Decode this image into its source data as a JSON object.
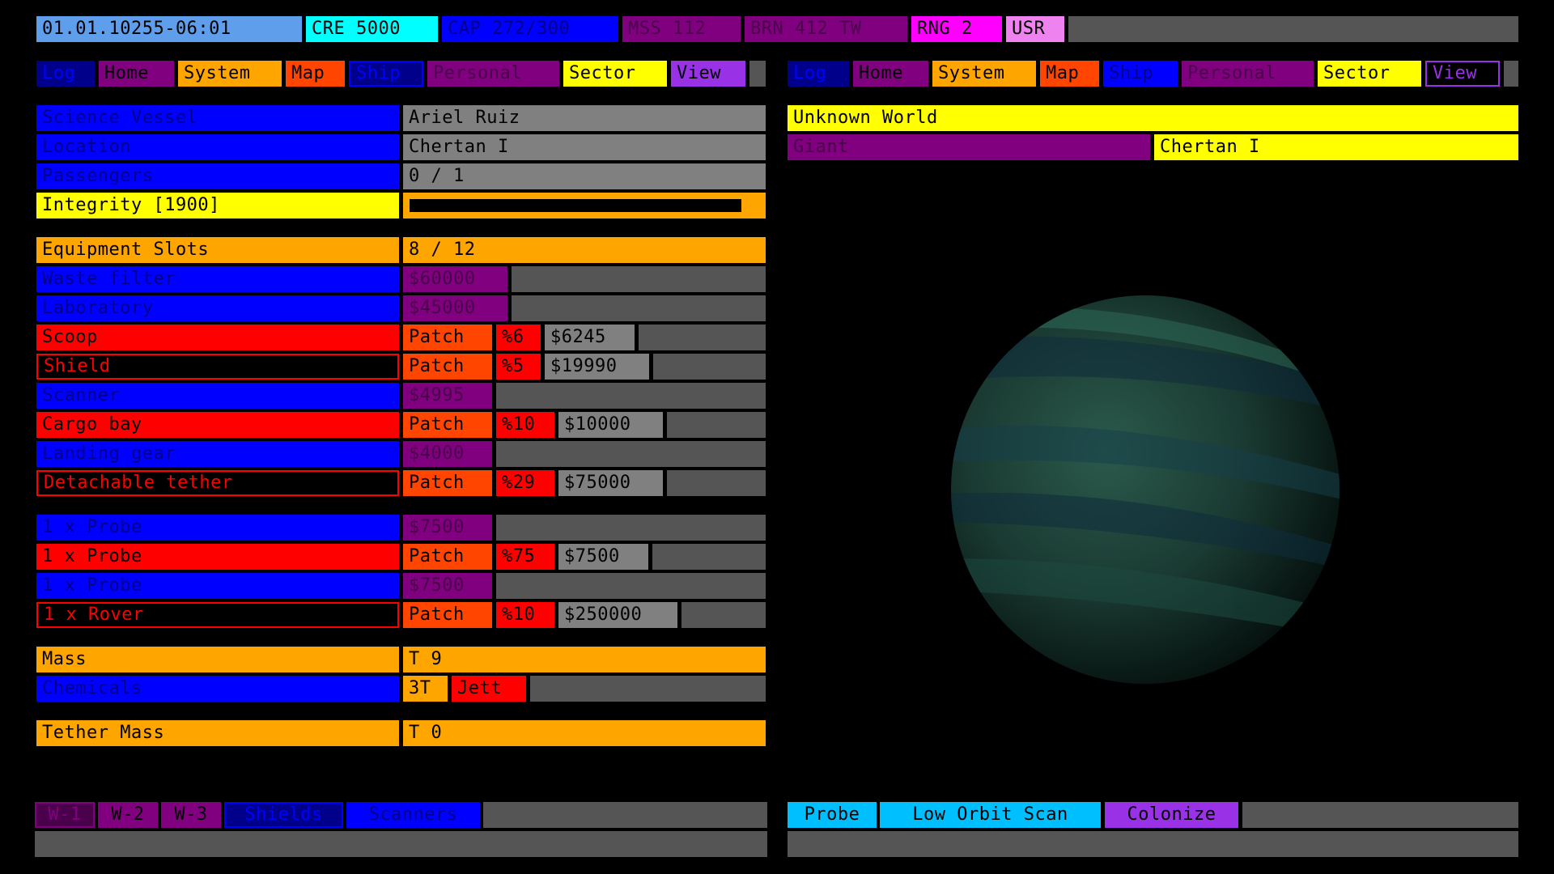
{
  "status_bar": {
    "date": "01.01.10255-06:01",
    "cre": "CRE 5000",
    "cap": "CAP 272/300",
    "mss": "MSS 112",
    "brn": "BRN 412 TW",
    "rng": "RNG 2",
    "usr": "USR"
  },
  "nav_left": [
    "Log",
    "Home",
    "System",
    "Map",
    "Ship",
    "Personal",
    "Sector",
    "View"
  ],
  "nav_right": [
    "Log",
    "Home",
    "System",
    "Map",
    "Ship",
    "Personal",
    "Sector",
    "View"
  ],
  "ship": {
    "class_label": "Science Vessel",
    "name": "Ariel Ruiz",
    "location_label": "Location",
    "location": "Chertan I",
    "passengers_label": "Passengers",
    "passengers": "0 / 1",
    "integrity_label": "Integrity [1900]",
    "integrity_fraction": 0.95,
    "slots_label": "Equipment Slots",
    "slots": "8 / 12"
  },
  "equipment": [
    {
      "name": "Waste filter",
      "price": "$60000"
    },
    {
      "name": "Laboratory",
      "price": "$45000"
    },
    {
      "name": "Scoop",
      "action": "Patch",
      "pct": "%6",
      "cost": "$6245"
    },
    {
      "name": "Shield",
      "action": "Patch",
      "pct": "%5",
      "cost": "$19990"
    },
    {
      "name": "Scanner",
      "price": "$4995"
    },
    {
      "name": "Cargo bay",
      "action": "Patch",
      "pct": "%10",
      "cost": "$10000"
    },
    {
      "name": "Landing gear",
      "price": "$4000"
    },
    {
      "name": "Detachable tether",
      "action": "Patch",
      "pct": "%29",
      "cost": "$75000"
    }
  ],
  "probes": [
    {
      "name": "1 x Probe",
      "price": "$7500"
    },
    {
      "name": "1 x Probe",
      "action": "Patch",
      "pct": "%75",
      "cost": "$7500"
    },
    {
      "name": "1 x Probe",
      "price": "$7500"
    },
    {
      "name": "1 x Rover",
      "action": "Patch",
      "pct": "%10",
      "cost": "$250000"
    }
  ],
  "cargo": {
    "mass_label": "Mass",
    "mass": "T 9",
    "chem_label": "Chemicals",
    "chem_qty": "3T",
    "chem_action": "Jett",
    "tether_label": "Tether Mass",
    "tether": "T 0"
  },
  "bottom_left": [
    "W-1",
    "W-2",
    "W-3",
    "Shields",
    "Scanners"
  ],
  "world": {
    "title": "Unknown World",
    "type": "Giant",
    "name": "Chertan I"
  },
  "bottom_right": [
    "Probe",
    "Low Orbit Scan",
    "Colonize"
  ],
  "colors": {
    "blue": "#0000ff",
    "orange": "#ffa500",
    "yellow": "#ffff00",
    "red": "#ff0000",
    "purple": "#800080",
    "gray": "#808080",
    "planet": "#1f4a3c"
  }
}
